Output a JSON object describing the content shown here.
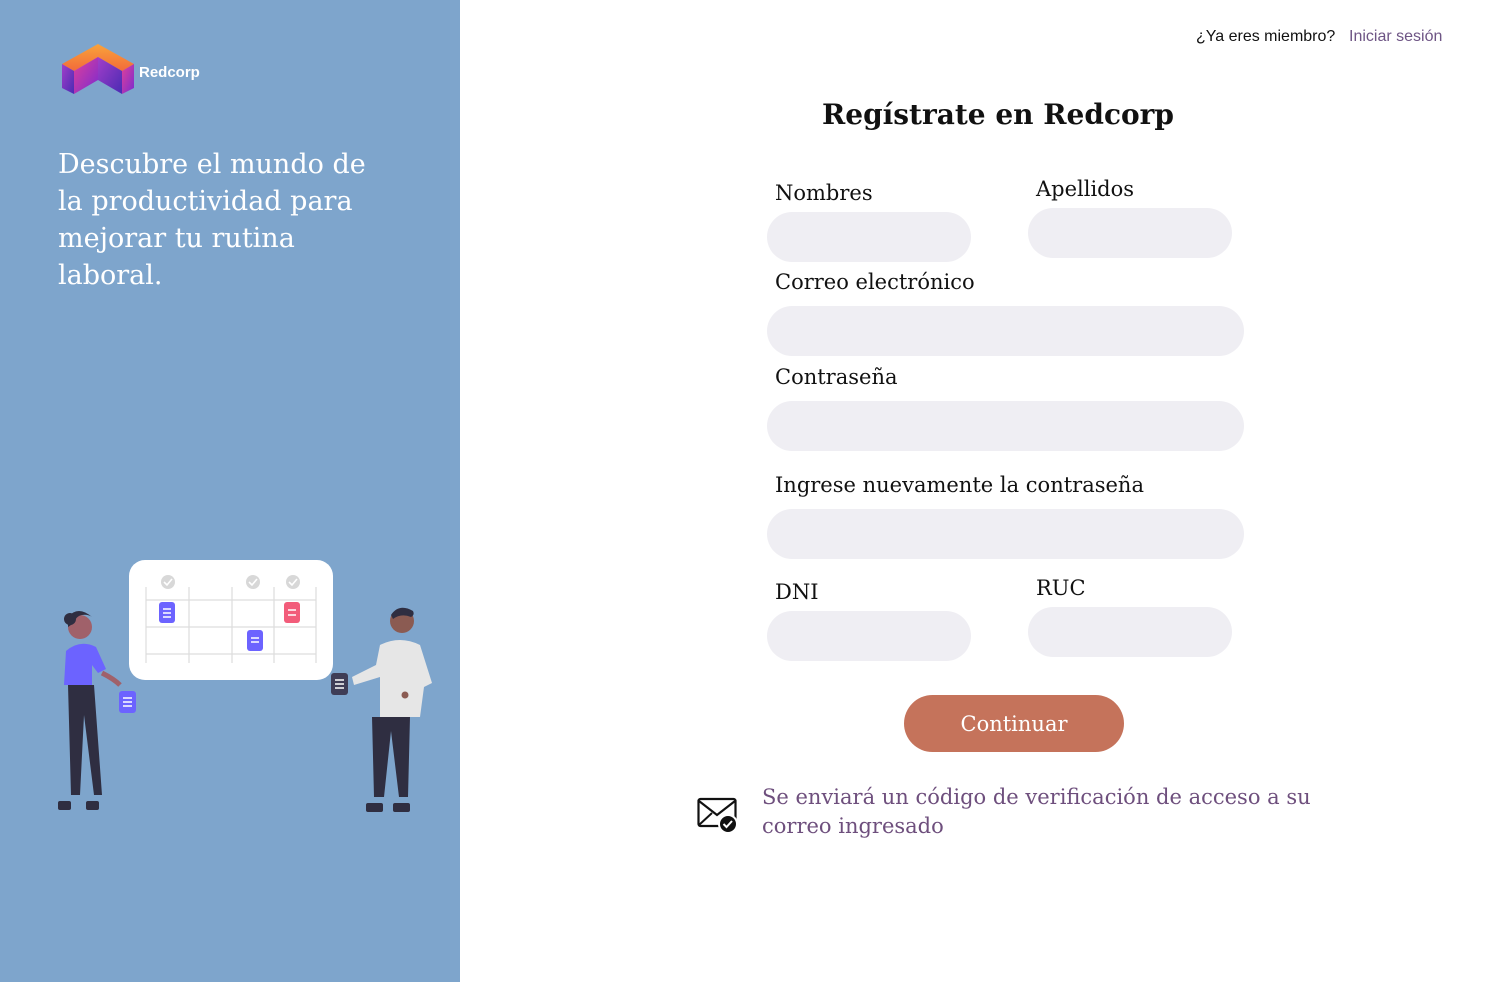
{
  "brand": {
    "name": "Redcorp"
  },
  "left_panel": {
    "tagline": "Descubre el mundo de la productividad para mejorar tu rutina laboral.",
    "illustration": "people-with-calendar-illustration"
  },
  "header": {
    "member_question": "¿Ya eres miembro?",
    "login_link": "Iniciar sesión"
  },
  "form": {
    "title": "Regístrate en Redcorp",
    "fields": {
      "nombres": {
        "label": "Nombres",
        "value": ""
      },
      "apellidos": {
        "label": "Apellidos",
        "value": ""
      },
      "correo": {
        "label": "Correo electrónico",
        "value": ""
      },
      "contrasena": {
        "label": "Contraseña",
        "value": ""
      },
      "contrasena_repetir": {
        "label": "Ingrese nuevamente la contraseña",
        "value": ""
      },
      "dni": {
        "label": "DNI",
        "value": ""
      },
      "ruc": {
        "label": "RUC",
        "value": ""
      }
    },
    "submit_label": "Continuar",
    "notice_icon": "mail-check-icon",
    "notice": "Se enviará un código de verificación de acceso a su correo ingresado"
  },
  "colors": {
    "left_panel_bg": "#7ea5cc",
    "field_bg": "#efeef3",
    "button_bg": "#c5735b",
    "link": "#6e5585",
    "notice_text": "#6e4f7d"
  }
}
